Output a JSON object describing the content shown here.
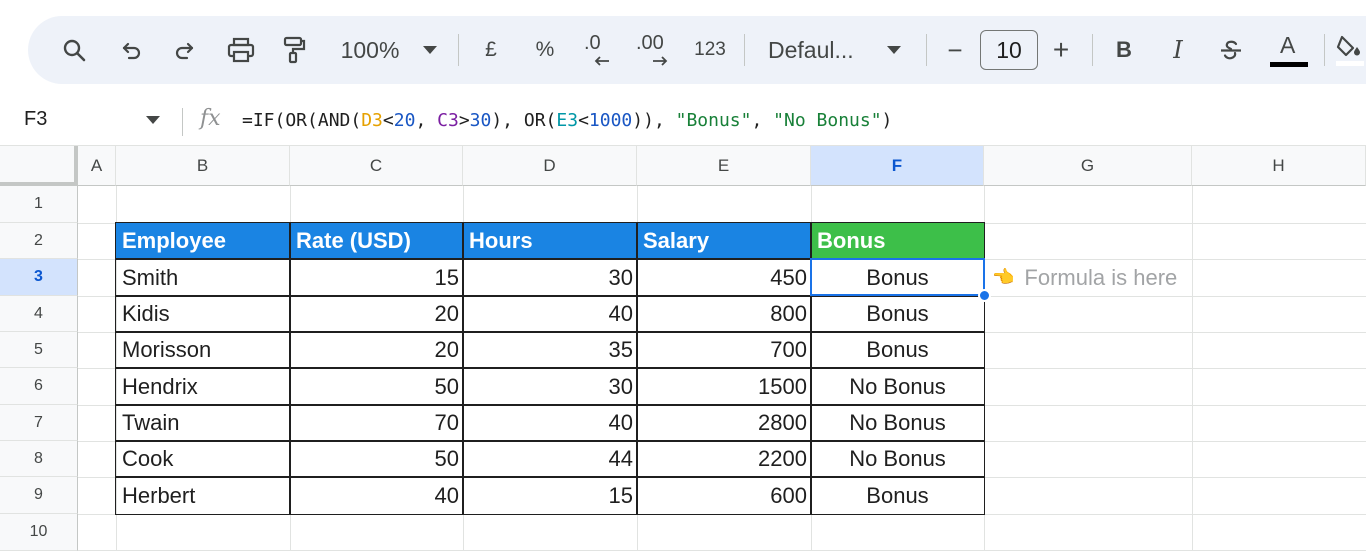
{
  "toolbar": {
    "zoom": "100%",
    "currency": "£",
    "percent": "%",
    "decrease_decimal": ".0",
    "increase_decimal": ".00",
    "number_format": "123",
    "font_name": "Defaul...",
    "font_size": "10",
    "decrease_font": "−",
    "increase_font": "+",
    "bold": "B",
    "italic": "I",
    "text_color_glyph": "A"
  },
  "formula_bar": {
    "name_box": "F3",
    "fx": "fx",
    "formula": {
      "p1": "=IF(OR(AND(",
      "r1": "D3",
      "p2": "<",
      "n1": "20",
      "p3": ", ",
      "r2": "C3",
      "p4": ">",
      "n2": "30",
      "p5": "), OR(",
      "r3": "E3",
      "p6": "<",
      "n3": "1000",
      "p7": ")), ",
      "s1": "\"Bonus\"",
      "p8": ", ",
      "s2": "\"No Bonus\"",
      "p9": ")"
    }
  },
  "columns": [
    "A",
    "B",
    "C",
    "D",
    "E",
    "F",
    "G",
    "H"
  ],
  "rows": [
    "1",
    "2",
    "3",
    "4",
    "5",
    "6",
    "7",
    "8",
    "9",
    "10"
  ],
  "table": {
    "headers": [
      "Employee",
      "Rate (USD)",
      "Hours",
      "Salary",
      "Bonus"
    ],
    "rows": [
      [
        "Smith",
        "15",
        "30",
        "450",
        "Bonus"
      ],
      [
        "Kidis",
        "20",
        "40",
        "800",
        "Bonus"
      ],
      [
        "Morisson",
        "20",
        "35",
        "700",
        "Bonus"
      ],
      [
        "Hendrix",
        "50",
        "30",
        "1500",
        "No Bonus"
      ],
      [
        "Twain",
        "70",
        "40",
        "2800",
        "No Bonus"
      ],
      [
        "Cook",
        "50",
        "44",
        "2200",
        "No Bonus"
      ],
      [
        "Herbert",
        "40",
        "15",
        "600",
        "Bonus"
      ]
    ]
  },
  "note": {
    "hand": "👈",
    "text": "Formula is here"
  },
  "colors": {
    "header_blue": "#1a84e3",
    "header_green": "#3dbf49",
    "selection": "#1a73e8"
  }
}
